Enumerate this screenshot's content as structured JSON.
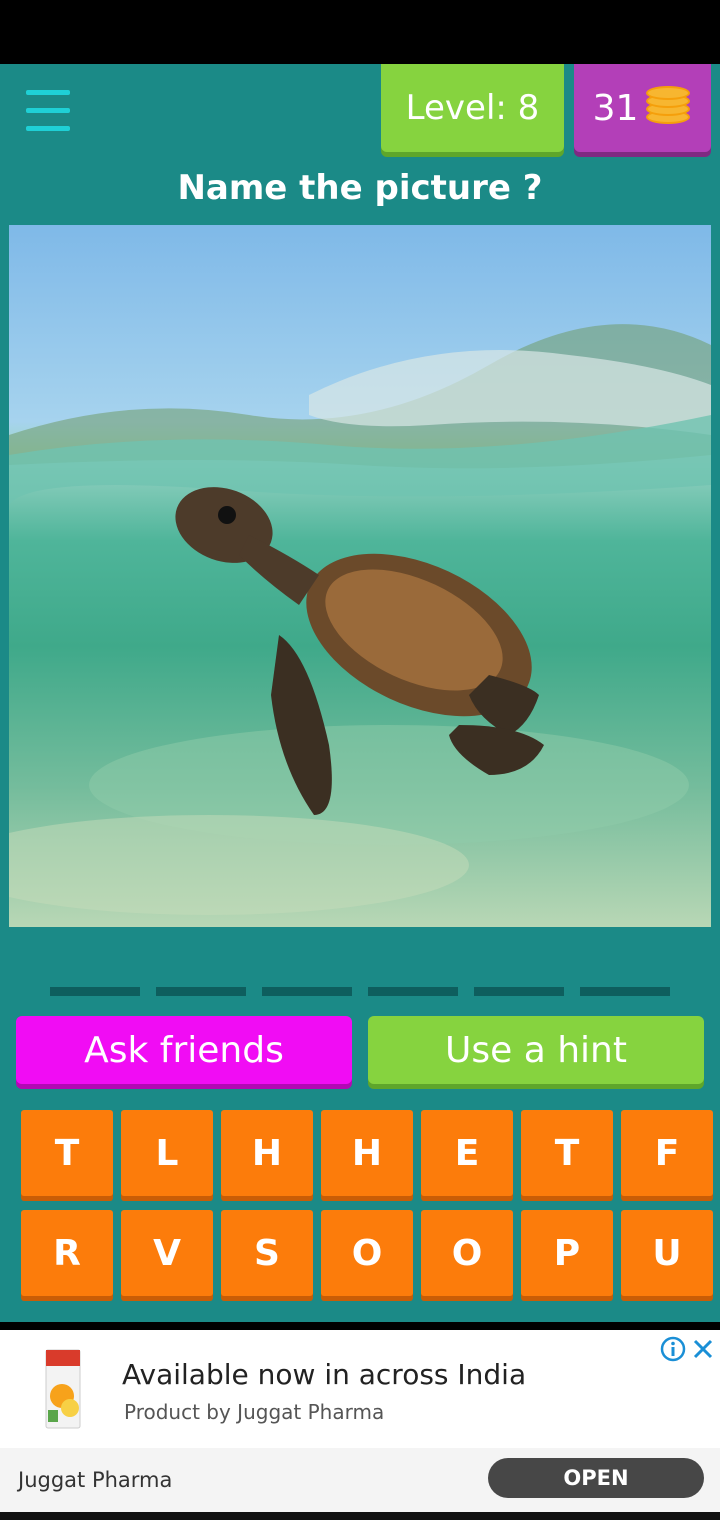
{
  "header": {
    "menu_icon": "hamburger-menu-icon",
    "level_label": "Level: 8",
    "coins_count": "31",
    "coins_icon": "coin-stack-icon"
  },
  "question": {
    "title": "Name the picture ?"
  },
  "answer": {
    "slots": [
      "",
      "",
      "",
      "",
      "",
      ""
    ]
  },
  "actions": {
    "ask_friends_label": "Ask friends",
    "hint_label": "Use a hint"
  },
  "keyboard": {
    "row1": [
      "T",
      "L",
      "H",
      "H",
      "E",
      "T",
      "F"
    ],
    "row2": [
      "R",
      "V",
      "S",
      "O",
      "O",
      "P",
      "U"
    ]
  },
  "ad": {
    "headline": "Available now in across India",
    "subline": "Product by Juggat Pharma",
    "advertiser": "Juggat Pharma",
    "cta_label": "OPEN",
    "info_icon": "ad-info-icon",
    "close_icon": "ad-close-icon"
  },
  "colors": {
    "background": "#1b8a87",
    "level_green": "#86d33f",
    "coins_purple": "#b33fb8",
    "ask_magenta": "#f10cf4",
    "key_orange": "#fc7c0b"
  }
}
